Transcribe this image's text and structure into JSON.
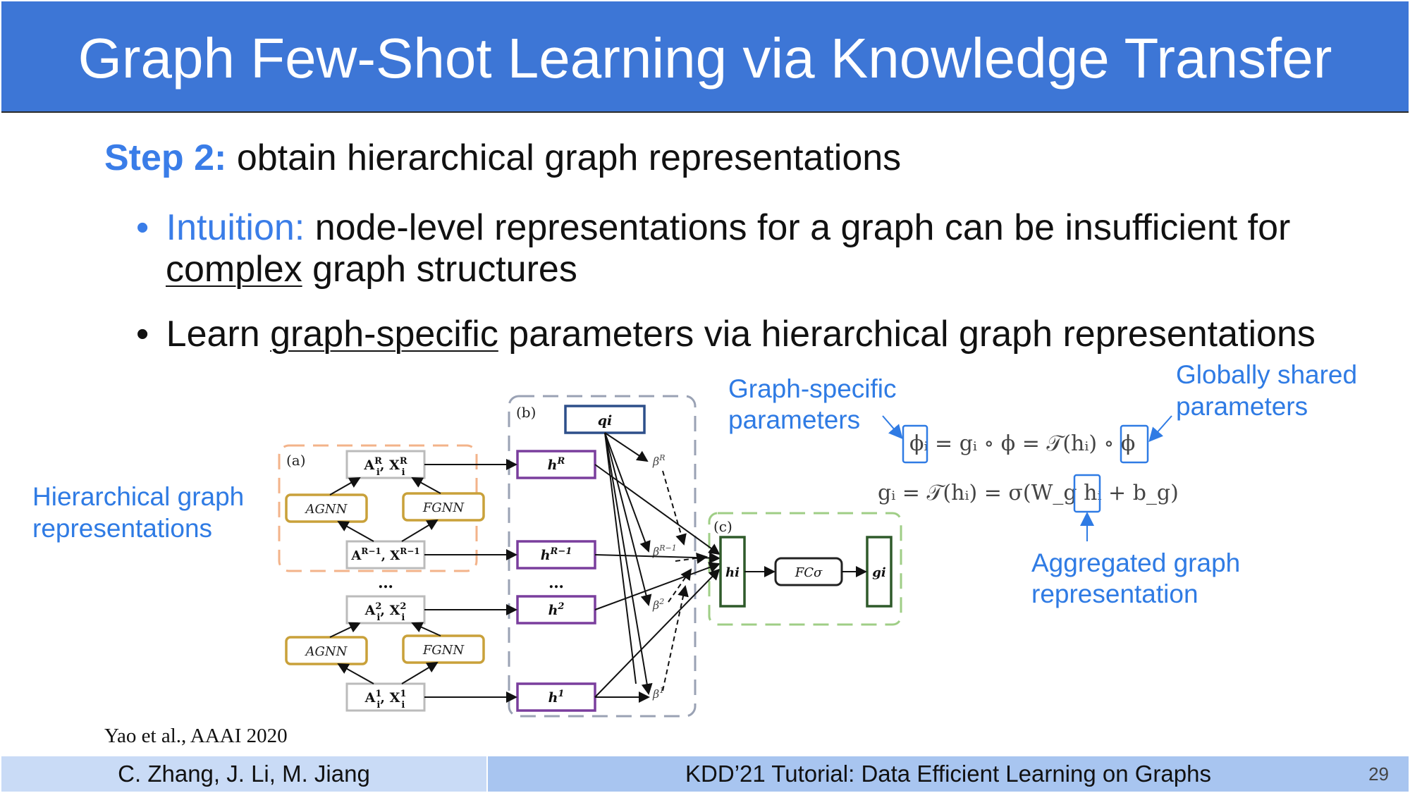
{
  "title": "Graph Few-Shot Learning via Knowledge Transfer",
  "step": {
    "label": "Step 2:",
    "text": "obtain hierarchical graph representations"
  },
  "bullets": [
    {
      "marker": "•",
      "label": "Intuition:",
      "text1": "node-level representations for a graph can be insufficient for",
      "emph": "complex",
      "text2": "graph structures"
    },
    {
      "marker": "•",
      "prefix": "Learn",
      "emph": "graph-specific",
      "suffix": "parameters via hierarchical graph representations"
    }
  ],
  "annotations": {
    "hier_line1": "Hierarchical graph",
    "hier_line2": "representations",
    "gs_line1": "Graph-specific",
    "gs_line2": "parameters",
    "glob_line1": "Globally shared",
    "glob_line2": "parameters",
    "agg_line1": "Aggregated graph",
    "agg_line2": "representation"
  },
  "diagram": {
    "panel_a": "(a)",
    "panel_b": "(b)",
    "panel_c": "(c)",
    "agnn": "AGNN",
    "fgnn": "FGNN",
    "q": "qi",
    "fc": "FCσ",
    "h": "hi",
    "g": "gi",
    "dots": "…"
  },
  "formulas": {
    "f1": "ϕᵢ = gᵢ ∘ ϕ = 𝒯(hᵢ) ∘ ϕ",
    "f2": "gᵢ = 𝒯(hᵢ) = σ(W_g hᵢ + b_g)"
  },
  "reference": "Yao et al., AAAI 2020",
  "footer": {
    "authors": "C. Zhang, J. Li, M. Jiang",
    "event": "KDD’21 Tutorial: Data Efficient Learning on Graphs",
    "page": "29"
  },
  "colors": {
    "title_bg": "#3d76d6",
    "accent": "#3a7de8",
    "orange": "#f3b38a",
    "gold": "#c9a13a",
    "purple": "#7a3e9d",
    "green": "#2f5a2a"
  }
}
